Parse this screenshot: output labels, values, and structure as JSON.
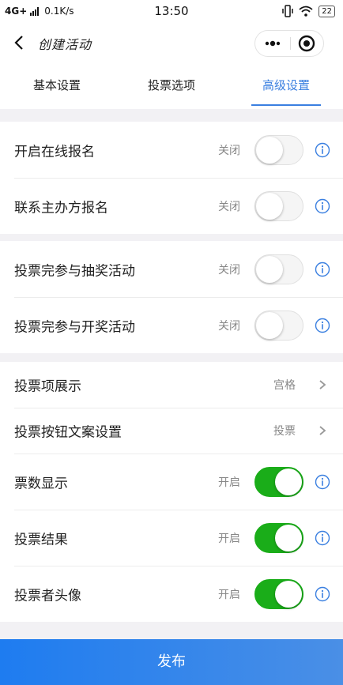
{
  "status_bar": {
    "network": "4G+",
    "speed": "0.1K/s",
    "time": "13:50",
    "battery": "22",
    "icons": [
      "signal-icon",
      "vibrate-icon",
      "wifi-icon",
      "battery-icon"
    ]
  },
  "nav": {
    "title": "创建活动",
    "back_icon": "chevron-left-icon",
    "more_icon": "more-dots-icon",
    "close_icon": "target-circle-icon"
  },
  "tabs": [
    {
      "label": "基本设置",
      "active": false
    },
    {
      "label": "投票选项",
      "active": false
    },
    {
      "label": "高级设置",
      "active": true
    }
  ],
  "sections": {
    "signup": [
      {
        "label": "开启在线报名",
        "state": "关闭",
        "on": false
      },
      {
        "label": "联系主办方报名",
        "state": "关闭",
        "on": false
      }
    ],
    "lottery": [
      {
        "label": "投票完参与抽奖活动",
        "state": "关闭",
        "on": false
      },
      {
        "label": "投票完参与开奖活动",
        "state": "关闭",
        "on": false
      }
    ],
    "display": {
      "options": [
        {
          "label": "投票项展示",
          "value": "宫格"
        },
        {
          "label": "投票按钮文案设置",
          "value": "投票"
        }
      ],
      "toggles": [
        {
          "label": "票数显示",
          "state": "开启",
          "on": true
        },
        {
          "label": "投票结果",
          "state": "开启",
          "on": true
        },
        {
          "label": "投票者头像",
          "state": "开启",
          "on": true
        }
      ]
    }
  },
  "publish_label": "发布",
  "colors": {
    "accent": "#3a7fe0",
    "switch_on": "#1aad19",
    "publish_bg": "#1e7cf0"
  }
}
